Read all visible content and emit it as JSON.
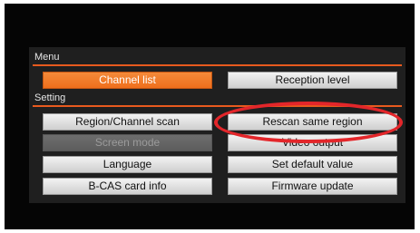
{
  "menu": {
    "section_label": "Menu",
    "items": [
      {
        "label": "Channel list",
        "state": "selected"
      },
      {
        "label": "Reception level",
        "state": "normal"
      }
    ]
  },
  "setting": {
    "section_label": "Setting",
    "items": [
      {
        "label": "Region/Channel scan",
        "state": "normal"
      },
      {
        "label": "Rescan same region",
        "state": "normal"
      },
      {
        "label": "Screen mode",
        "state": "disabled"
      },
      {
        "label": "Video output",
        "state": "normal"
      },
      {
        "label": "Language",
        "state": "normal"
      },
      {
        "label": "Set default value",
        "state": "normal"
      },
      {
        "label": "B-CAS card info",
        "state": "normal"
      },
      {
        "label": "Firmware update",
        "state": "normal"
      }
    ]
  },
  "colors": {
    "accent": "#ef6f1c",
    "divider": "#e85a1e",
    "highlight_ring": "#e3262a",
    "panel_bg": "#1f1f1f"
  }
}
